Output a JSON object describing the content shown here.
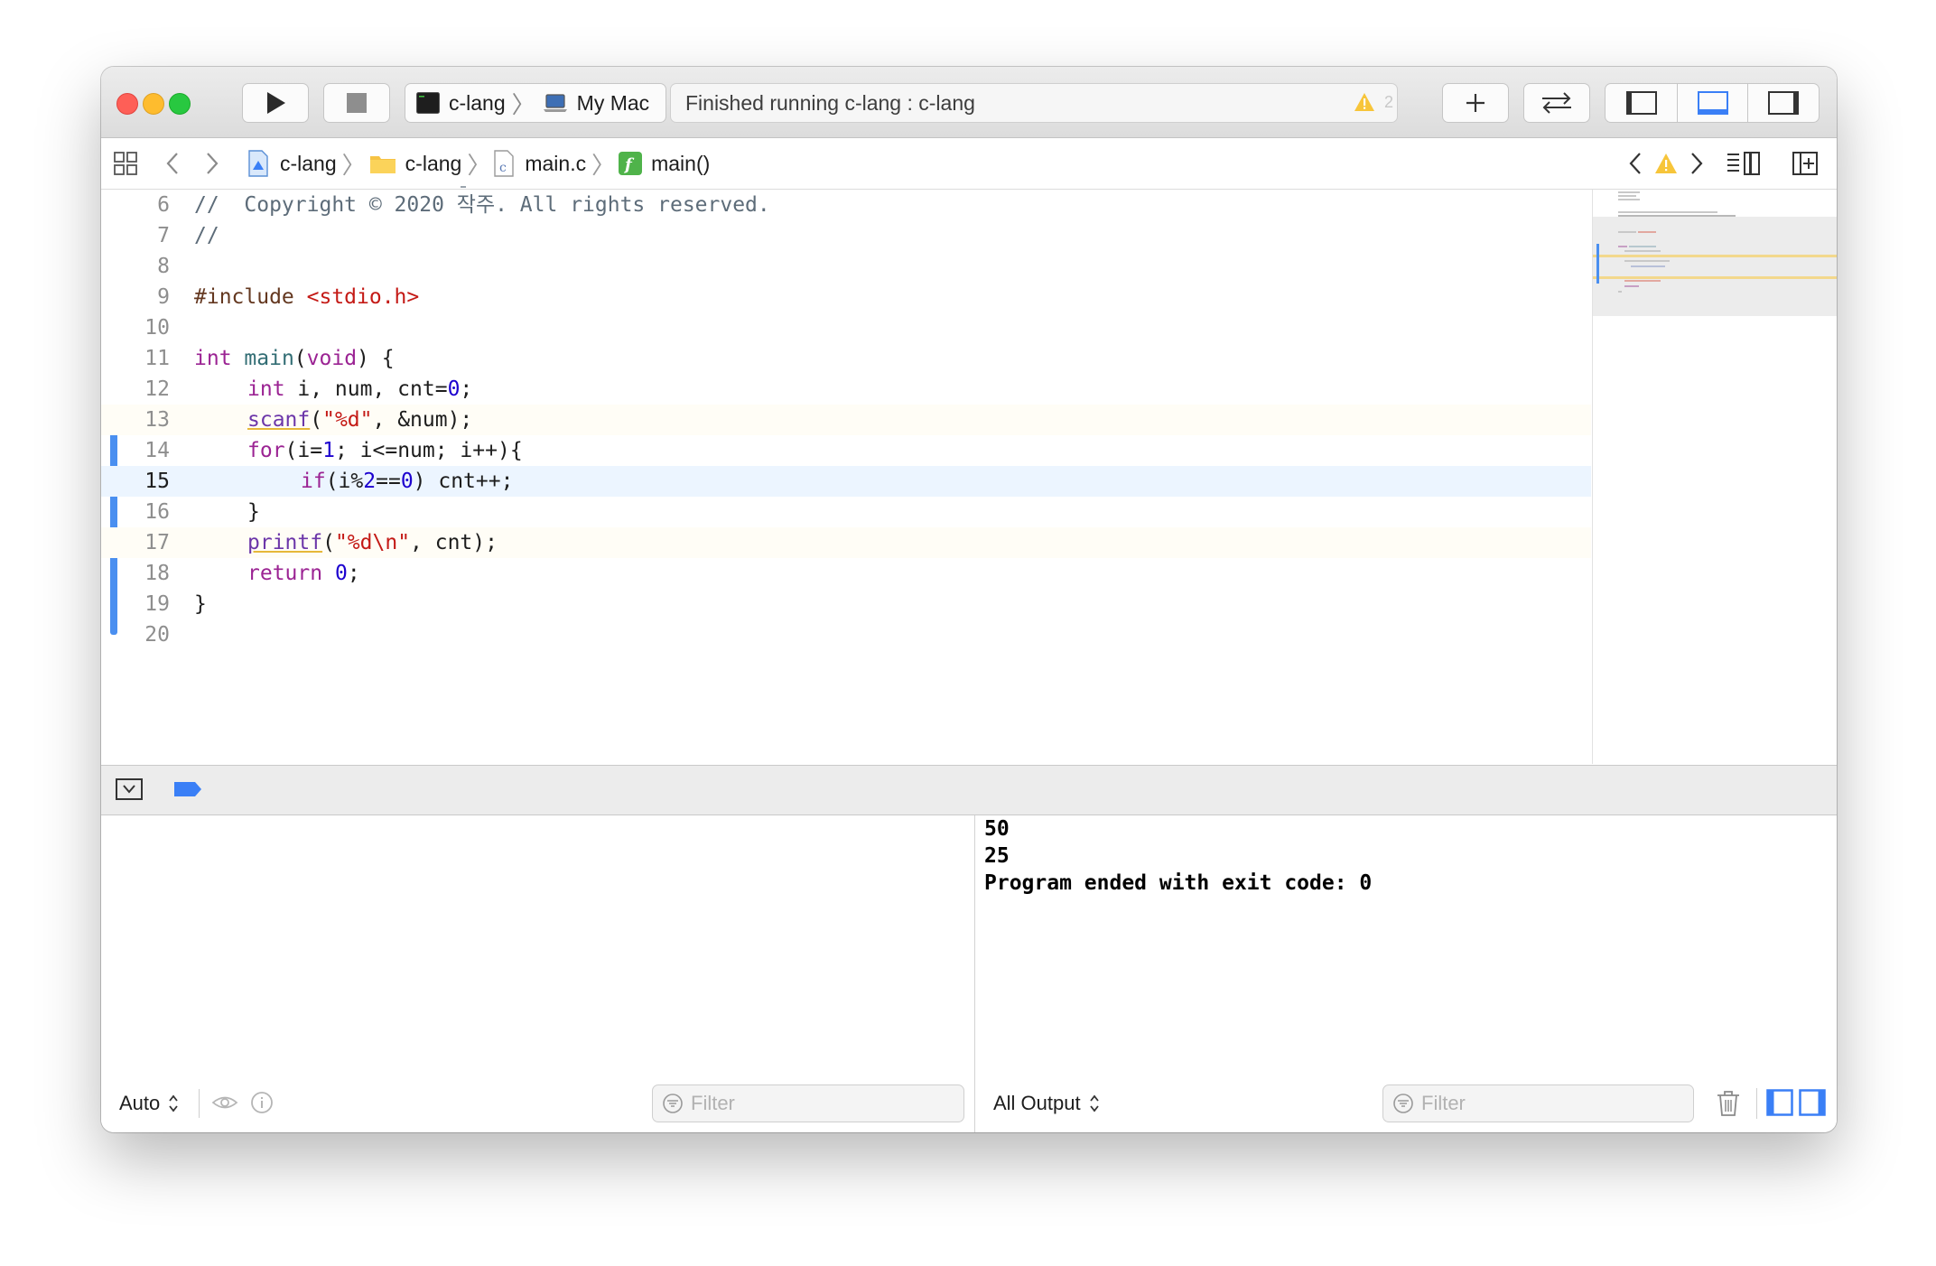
{
  "toolbar": {
    "scheme_target": "c-lang",
    "scheme_device": "My Mac",
    "activity_status": "Finished running c-lang : c-lang",
    "warning_count": "2"
  },
  "jumpbar": {
    "crumbs": [
      "c-lang",
      "c-lang",
      "main.c",
      "main()"
    ]
  },
  "editor": {
    "current_line": "15",
    "lines": [
      {
        "num": "6"
      },
      {
        "num": "7"
      },
      {
        "num": "8"
      },
      {
        "num": "9"
      },
      {
        "num": "10"
      },
      {
        "num": "11"
      },
      {
        "num": "12"
      },
      {
        "num": "13"
      },
      {
        "num": "14"
      },
      {
        "num": "15"
      },
      {
        "num": "16"
      },
      {
        "num": "17"
      },
      {
        "num": "18"
      },
      {
        "num": "19"
      },
      {
        "num": "20"
      }
    ],
    "code": {
      "l6": "//  Copyright © 2020 작주. All rights reserved.",
      "l7": "//",
      "l9_a": "#include ",
      "l9_b": "<stdio.h>",
      "l11_a": "int",
      "l11_b": "main",
      "l11_c": "(",
      "l11_d": "void",
      "l11_e": ") {",
      "l12_a": "int",
      "l12_b": " i, num, cnt=",
      "l12_c": "0",
      "l12_d": ";",
      "l13_a": "scanf",
      "l13_b": "(",
      "l13_c": "\"%d\"",
      "l13_d": ", &num);",
      "l14_a": "for",
      "l14_b": "(i=",
      "l14_c": "1",
      "l14_d": "; i<=num; i++){",
      "l15_a": "if",
      "l15_b": "(i%",
      "l15_c": "2",
      "l15_d": "==",
      "l15_e": "0",
      "l15_f": ") cnt++;",
      "l16": "}",
      "l17_a": "printf",
      "l17_b": "(",
      "l17_c": "\"%d\\n\"",
      "l17_d": ", cnt);",
      "l18_a": "return",
      "l18_b": " ",
      "l18_c": "0",
      "l18_d": ";",
      "l19": "}"
    }
  },
  "console": {
    "output_lines": [
      "50",
      "25",
      "Program ended with exit code: 0"
    ]
  },
  "variables_pane": {
    "scope_label": "Auto",
    "filter_placeholder": "Filter"
  },
  "console_pane": {
    "output_label": "All Output",
    "filter_placeholder": "Filter"
  },
  "colors": {
    "accent": "#3a7ff6",
    "close": "#fe5f57",
    "minimize": "#febc2e",
    "zoom": "#28c840",
    "warning": "#f7c53a"
  }
}
